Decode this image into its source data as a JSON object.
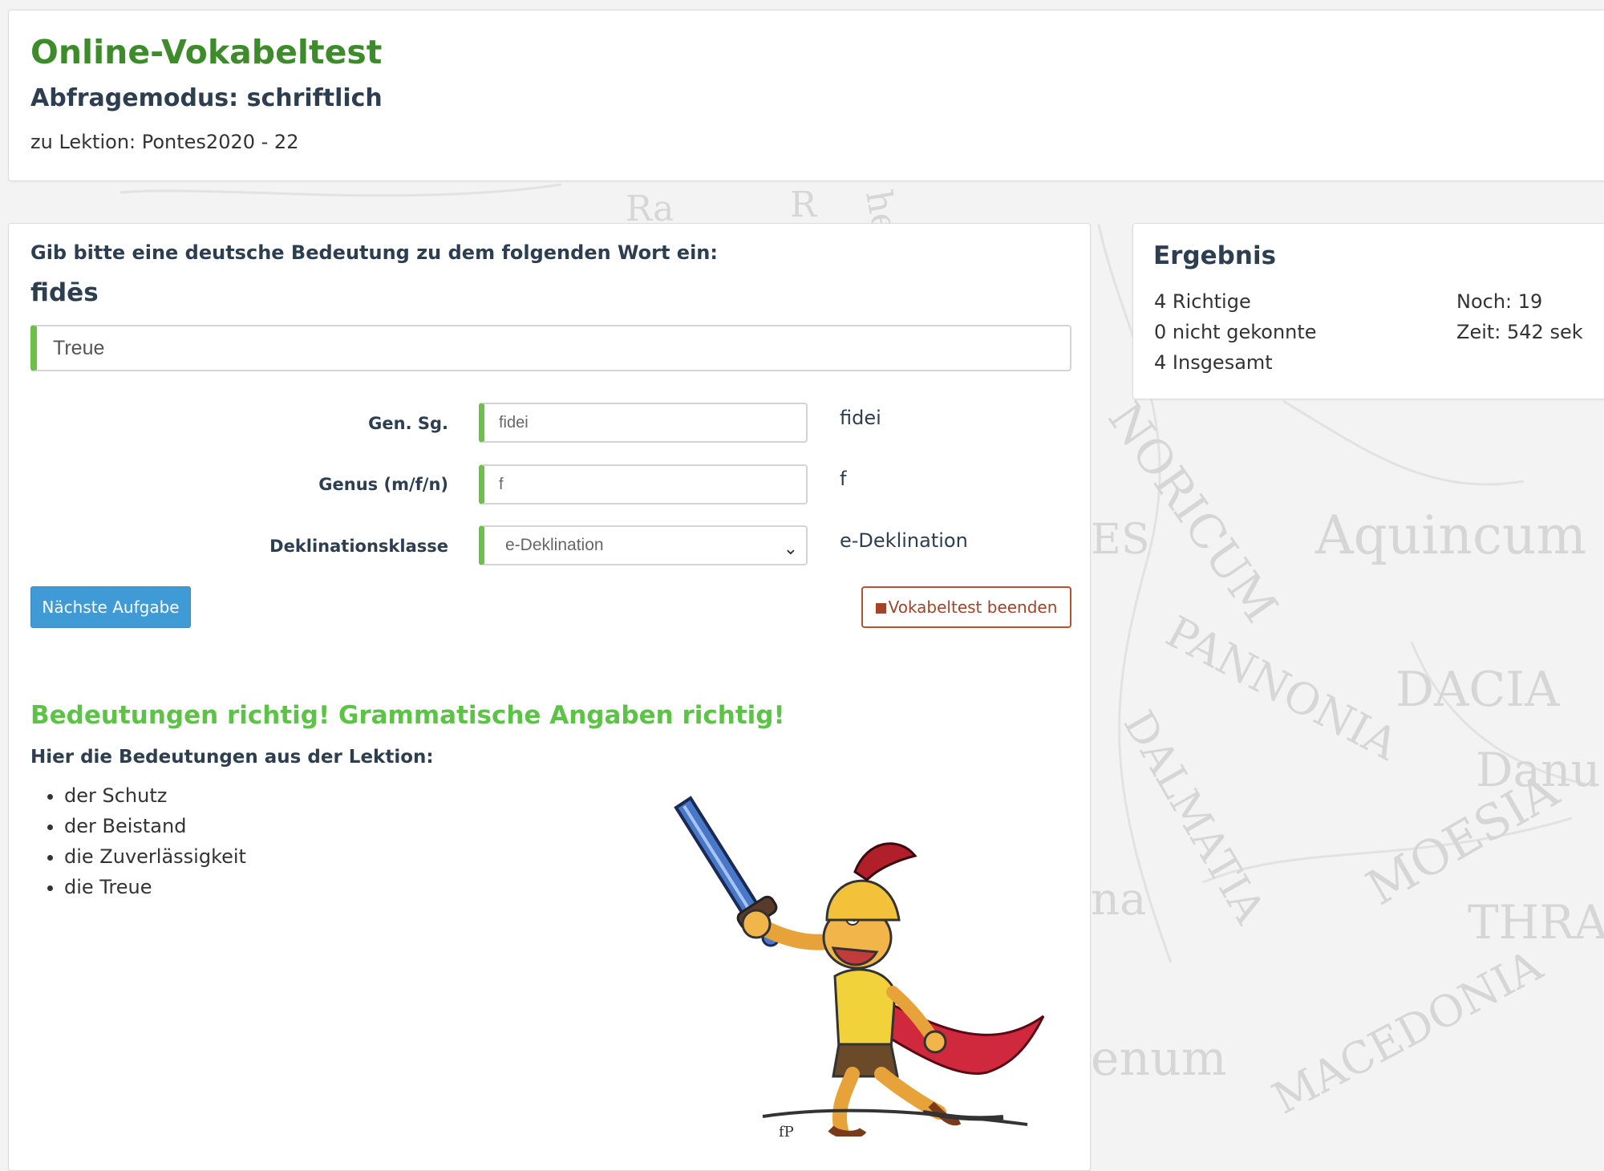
{
  "header": {
    "title": "Online-Vokabeltest",
    "mode": "Abfragemodus: schriftlich",
    "lesson": "zu Lektion: Pontes2020 - 22"
  },
  "question": {
    "prompt": "Gib bitte eine deutsche Bedeutung zu dem folgenden Wort ein:",
    "word": "fidēs",
    "meaning_input_value": "Treue"
  },
  "grammar": {
    "fields": [
      {
        "label": "Gen. Sg.",
        "value": "fidei",
        "answer": "fidei"
      },
      {
        "label": "Genus (m/f/n)",
        "value": "f",
        "answer": "f"
      },
      {
        "label": "Deklinationsklasse",
        "value": "e-Deklination",
        "answer": "e-Deklination"
      }
    ]
  },
  "buttons": {
    "next": "Nächste Aufgabe",
    "end": "Vokabeltest beenden"
  },
  "feedback": {
    "message": "Bedeutungen richtig! Grammatische Angaben richtig!",
    "lesson_meanings_heading": "Hier die Bedeutungen aus der Lektion:",
    "meanings": [
      "der Schutz",
      "der Beistand",
      "die Zuverlässigkeit",
      "die Treue"
    ]
  },
  "result": {
    "title": "Ergebnis",
    "correct": "4 Richtige",
    "unknown": "0 nicht gekonnte",
    "total": "4 Insgesamt",
    "remaining": "Noch: 19",
    "time": "Zeit: 542 sek"
  },
  "background_map": {
    "labels": [
      "NORICUM",
      "Aquincum",
      "PANNONIA",
      "DACIA",
      "DALMATIA",
      "Danu",
      "MOESIA",
      "THRAC",
      "MACEDONIA",
      "enum",
      "na",
      "ES",
      "he",
      "Ra",
      "R"
    ]
  },
  "colors": {
    "title_green": "#3d8b2b",
    "success_green": "#5cc347",
    "input_accent": "#6cc04a",
    "primary_button": "#3f9ad6",
    "danger_outline": "#b5522f"
  },
  "icons": {
    "stop": "stop-icon",
    "select_chevron": "chevron-down-icon"
  }
}
